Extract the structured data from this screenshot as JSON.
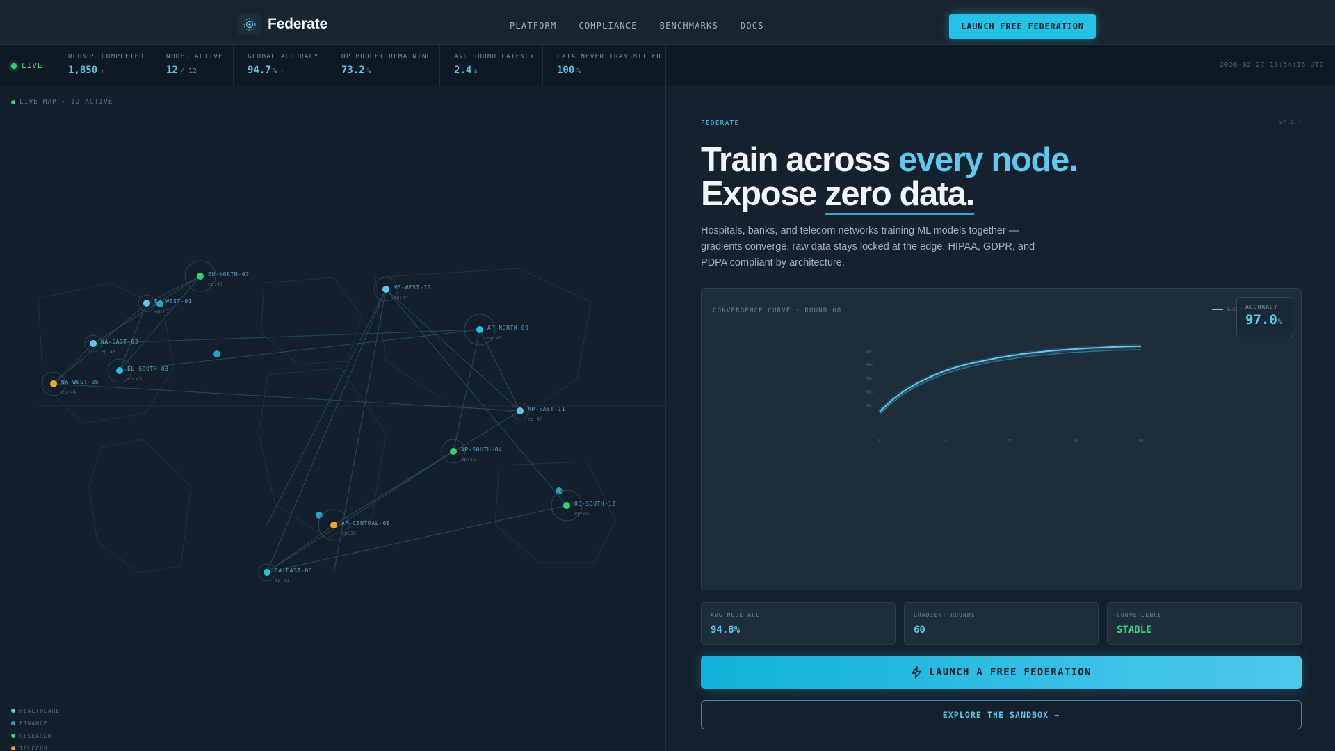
{
  "nav": {
    "brand": "Federate",
    "links": [
      "PLATFORM",
      "COMPLIANCE",
      "BENCHMARKS",
      "DOCS"
    ],
    "cta": "LAUNCH FREE FEDERATION"
  },
  "status": {
    "live": "LIVE",
    "timestamp": "2026-02-27 13:54:16 UTC",
    "stats": [
      {
        "label": "ROUNDS COMPLETED",
        "value": "1,850",
        "unit": "",
        "trend": "↑"
      },
      {
        "label": "NODES ACTIVE",
        "value": "12",
        "unit": "/ 12",
        "trend": ""
      },
      {
        "label": "GLOBAL ACCURACY",
        "value": "94.7",
        "unit": "%",
        "trend": "↑"
      },
      {
        "label": "DP BUDGET REMAINING",
        "value": "73.2",
        "unit": "%",
        "trend": ""
      },
      {
        "label": "AVG ROUND LATENCY",
        "value": "2.4",
        "unit": "s",
        "trend": ""
      },
      {
        "label": "DATA NEVER TRANSMITTED",
        "value": "100",
        "unit": "%",
        "trend": ""
      }
    ]
  },
  "map": {
    "header": "LIVE MAP · 12 ACTIVE",
    "nodes": [
      {
        "id": "EU-NORTH-07",
        "ep": "ep:46",
        "color": "#2ed573"
      },
      {
        "id": "EU-WEST-01",
        "ep": "ep:47",
        "color": "#5fc8ef"
      },
      {
        "id": "NA-EAST-03",
        "ep": "ep:48",
        "color": "#5fc8ef"
      },
      {
        "id": "EU-SOUTH-03",
        "ep": "ep:45",
        "color": "#22c3e6"
      },
      {
        "id": "NA-WEST-05",
        "ep": "ep:44",
        "color": "#f5a623"
      },
      {
        "id": "ME-WEST-10",
        "ep": "ep:44",
        "color": "#5fc8ef"
      },
      {
        "id": "AP-NORTH-09",
        "ep": "ep:43",
        "color": "#22c3e6"
      },
      {
        "id": "AP-EAST-11",
        "ep": "ep:47",
        "color": "#5fc8ef"
      },
      {
        "id": "AP-SOUTH-04",
        "ep": "ep:43",
        "color": "#2ed573"
      },
      {
        "id": "OC-SOUTH-12",
        "ep": "ep:46",
        "color": "#2ed573"
      },
      {
        "id": "AF-CENTRAL-08",
        "ep": "ep:39",
        "color": "#f5a623"
      },
      {
        "id": "SA-EAST-06",
        "ep": "ep:41",
        "color": "#22c3e6"
      }
    ],
    "legend": [
      {
        "label": "HEALTHCARE",
        "color": "#5fc8ef"
      },
      {
        "label": "FINANCE",
        "color": "#22a6c6"
      },
      {
        "label": "RESEARCH",
        "color": "#2ed573"
      },
      {
        "label": "TELECOM",
        "color": "#f5a623"
      }
    ]
  },
  "hero": {
    "eyebrow": "FEDERATE",
    "version": "v2.4.1",
    "headline_line1_plain": "Train across ",
    "headline_line1_accent": "every node.",
    "headline_line2_plain": "Expose ",
    "headline_line2_underlined": "zero data.",
    "subcopy": "Hospitals, banks, and telecom networks training ML models together — gradients converge, raw data stays locked at the edge. HIPAA, GDPR, and PDPA compliant by architecture."
  },
  "chart_card": {
    "title": "CONVERGENCE CURVE · ROUND 60",
    "legend_label": "GLOBAL",
    "accuracy_label": "ACCURACY",
    "accuracy_value": "97.0",
    "accuracy_unit": "%"
  },
  "chart_data": {
    "type": "line",
    "title": "CONVERGENCE CURVE · ROUND 60",
    "xlabel": "",
    "ylabel": "",
    "x_ticks": [
      "0",
      "15",
      "30",
      "45",
      "60"
    ],
    "y_ticks": [
      "90%",
      "80%",
      "70%",
      "60%",
      "50%"
    ],
    "xlim": [
      0,
      60
    ],
    "ylim": [
      45,
      95
    ],
    "series": [
      {
        "name": "GLOBAL",
        "x": [
          0,
          3,
          6,
          9,
          12,
          15,
          18,
          21,
          24,
          27,
          30,
          33,
          36,
          39,
          42,
          45,
          48,
          51,
          54,
          57,
          60
        ],
        "y": [
          45.5,
          54.5,
          61.5,
          67,
          71.5,
          75.5,
          78.5,
          81,
          83,
          85,
          86.5,
          88,
          89,
          90,
          90.8,
          91.5,
          92.1,
          92.6,
          93,
          93.3,
          93.5
        ]
      }
    ],
    "grid": false,
    "legend_position": "top-right",
    "color": "#5fc8ef"
  },
  "metrics": [
    {
      "label": "AVG NODE ACC",
      "value": "94.8%",
      "color": "#58c7ea"
    },
    {
      "label": "GRADIENT ROUNDS",
      "value": "60",
      "color": "#58c7ea"
    },
    {
      "label": "CONVERGENCE",
      "value": "STABLE",
      "color": "#2ed573"
    }
  ],
  "buttons": {
    "primary": "LAUNCH A FREE FEDERATION",
    "secondary": "EXPLORE THE SANDBOX →"
  }
}
